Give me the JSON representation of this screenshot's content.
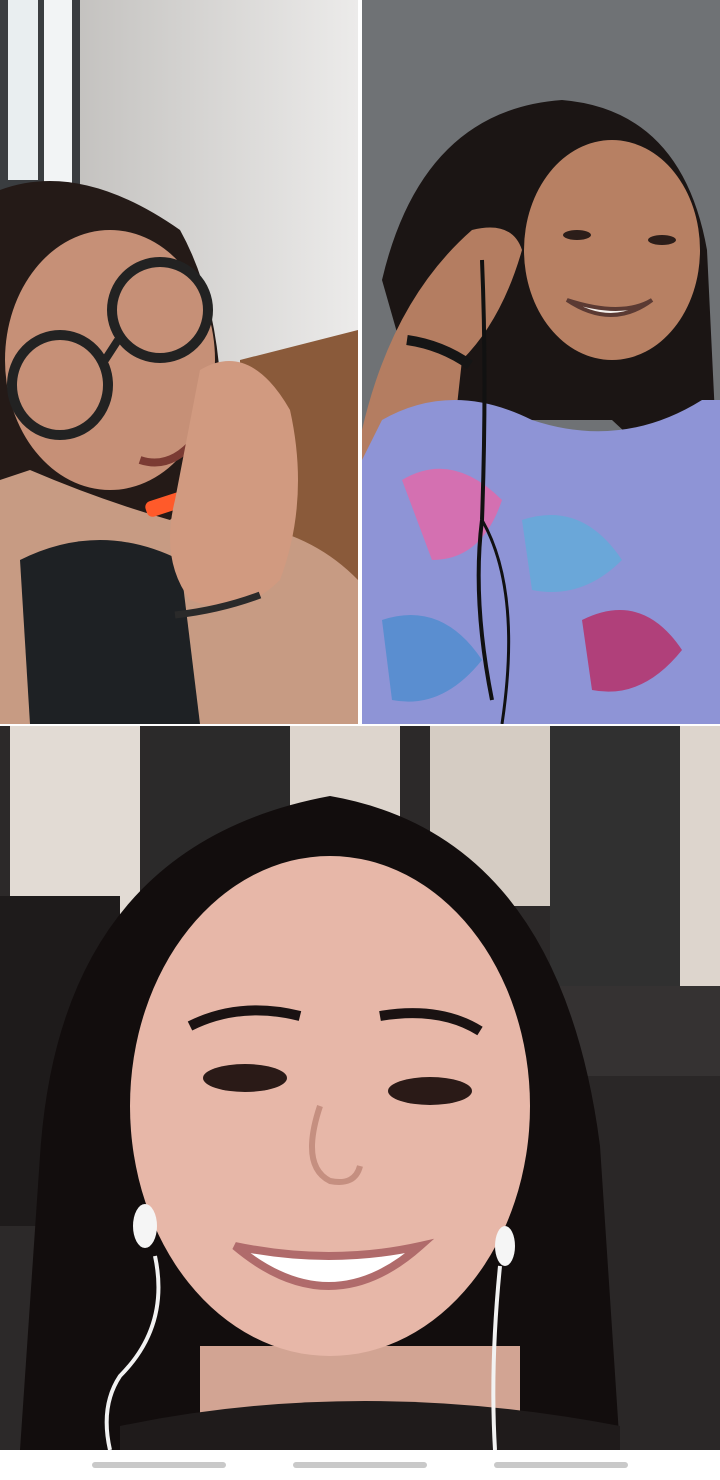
{
  "app": {
    "type": "group-video-call"
  },
  "participants": [
    {
      "tile": "top-left",
      "camera_on": true
    },
    {
      "tile": "top-right",
      "camera_on": true
    },
    {
      "tile": "bottom",
      "camera_on": true,
      "self_view": true
    }
  ],
  "nav_bar": {
    "buttons": [
      "recent-apps",
      "home",
      "back"
    ]
  },
  "colors": {
    "background": "#ffffff",
    "nav_pill": "#c9c9c9"
  }
}
